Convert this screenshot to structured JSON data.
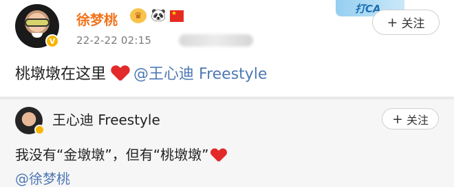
{
  "post": {
    "username": "徐梦桃",
    "timestamp": "22-2-22 02:15",
    "follow_label": "关注",
    "text": "桃墩墩在这里",
    "mention": "@王心迪 Freestyle",
    "promo_text": "打CA",
    "badges": [
      "crown-badge-icon",
      "panda-icon",
      "china-flag-icon"
    ]
  },
  "repost": {
    "username": "王心迪 Freestyle",
    "follow_label": "关注",
    "text": "我没有“金墩墩”，但有“桃墩墩”",
    "mention": "@徐梦桃"
  },
  "colors": {
    "username_orange": "#f0741d",
    "mention_blue": "#4d78b3",
    "heart_red": "#e22a2a",
    "verify_gold": "#f8b400"
  }
}
